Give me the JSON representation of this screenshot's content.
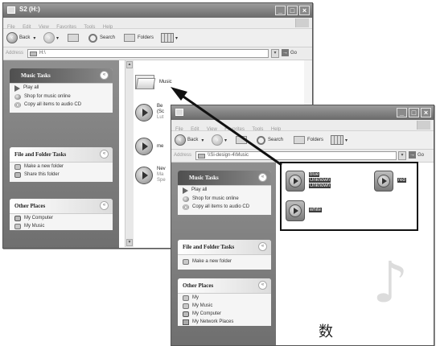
{
  "back_window": {
    "title": "S2 (H:)",
    "menu": [
      "File",
      "Edit",
      "View",
      "Favorites",
      "Tools",
      "Help"
    ],
    "toolbar": {
      "back": "Back",
      "search": "Search",
      "folders": "Folders"
    },
    "address": {
      "label": "Address",
      "value": "H:\\",
      "go": "Go"
    },
    "tasks": {
      "music": {
        "title": "Music Tasks",
        "items": [
          "Play all",
          "Shop for music online",
          "Copy all items to audio CD"
        ]
      },
      "file": {
        "title": "File and Folder Tasks",
        "items": [
          "Make a new folder",
          "Share this folder"
        ]
      },
      "other": {
        "title": "Other Places",
        "items": [
          "My Computer",
          "My Music"
        ]
      }
    },
    "files": [
      {
        "name": "Music",
        "sub": ""
      },
      {
        "name": "Be",
        "sub": "(Sc",
        "sub2": "Lut"
      },
      {
        "name": "me",
        "sub": ""
      },
      {
        "name": "Nev",
        "sub": "Ma",
        "sub2": "Spe"
      }
    ]
  },
  "front_window": {
    "menu": [
      "File",
      "Edit",
      "View",
      "Favorites",
      "Tools",
      "Help"
    ],
    "toolbar": {
      "back": "Back",
      "search": "Search",
      "folders": "Folders"
    },
    "address": {
      "label": "Address",
      "value": "\\\\Si-design-4\\Music",
      "go": "Go"
    },
    "tasks": {
      "music": {
        "title": "Music Tasks",
        "items": [
          "Play all",
          "Shop for music online",
          "Copy all items to audio CD"
        ]
      },
      "file": {
        "title": "File and Folder Tasks",
        "items": [
          "Make a new folder"
        ]
      },
      "other": {
        "title": "Other Places",
        "items": [
          "My",
          "My Music",
          "My Computer",
          "My Network Places"
        ]
      }
    },
    "files": [
      {
        "name": "blue",
        "sub1": "Unknown",
        "sub2": "Unknown"
      },
      {
        "name": "red"
      },
      {
        "name": "white"
      }
    ]
  },
  "caption_glyph": "数",
  "icons": {
    "music_note": "music-note-icon",
    "arrow": "pointer-arrow"
  }
}
